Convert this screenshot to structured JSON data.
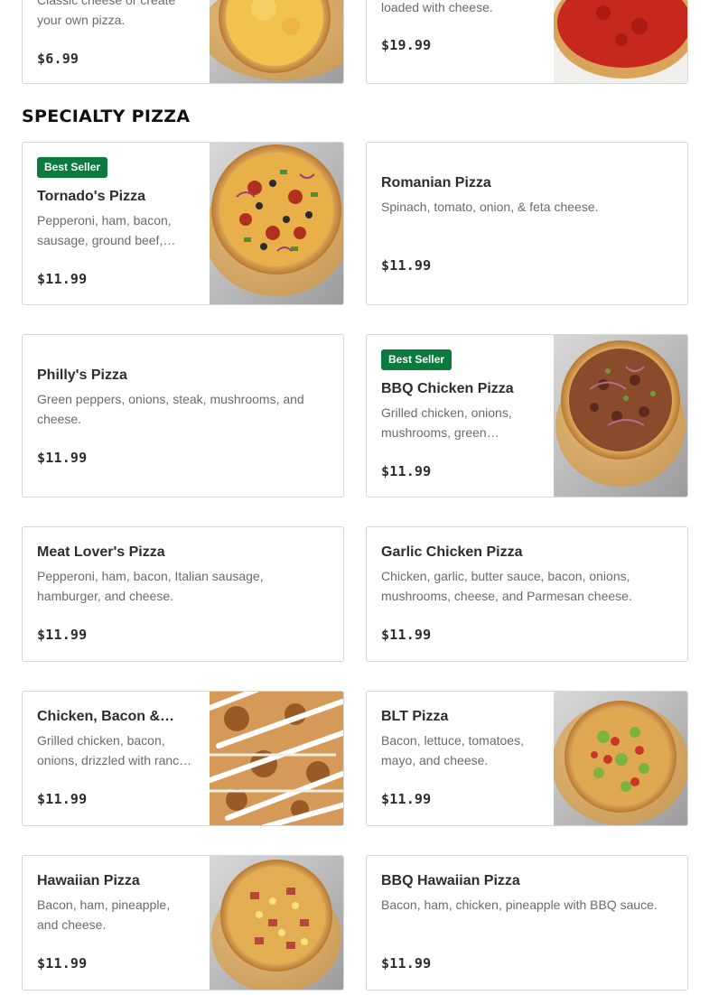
{
  "top_items": [
    {
      "desc": "Classic cheese or create your own pizza.",
      "price": "$6.99"
    },
    {
      "desc": "loaded with cheese.",
      "price": "$19.99"
    }
  ],
  "section": {
    "title": "SPECIALTY PIZZA"
  },
  "badge_label": "Best Seller",
  "items": [
    {
      "name": "Tornado's Pizza",
      "desc": "Pepperoni, ham, bacon, sausage, ground beef,…",
      "price": "$11.99"
    },
    {
      "name": "Romanian Pizza",
      "desc": "Spinach, tomato, onion, & feta cheese.",
      "price": "$11.99"
    },
    {
      "name": "Philly's Pizza",
      "desc": "Green peppers, onions, steak, mushrooms, and cheese.",
      "price": "$11.99"
    },
    {
      "name": "BBQ Chicken Pizza",
      "desc": "Grilled chicken, onions, mushrooms, green…",
      "price": "$11.99"
    },
    {
      "name": "Meat Lover's Pizza",
      "desc": "Pepperoni, ham, bacon, Italian sausage, hamburger, and cheese.",
      "price": "$11.99"
    },
    {
      "name": "Garlic Chicken Pizza",
      "desc": "Chicken, garlic, butter sauce, bacon, onions, mushrooms, cheese, and Parmesan cheese.",
      "price": "$11.99"
    },
    {
      "name": "Chicken, Bacon &…",
      "desc": "Grilled chicken, bacon, onions, drizzled with ranc…",
      "price": "$11.99"
    },
    {
      "name": "BLT Pizza",
      "desc": "Bacon, lettuce, tomatoes, mayo, and cheese.",
      "price": "$11.99"
    },
    {
      "name": "Hawaiian Pizza",
      "desc": "Bacon, ham, pineapple, and cheese.",
      "price": "$11.99"
    },
    {
      "name": "BBQ Hawaiian Pizza",
      "desc": "Bacon, ham, chicken, pineapple with BBQ sauce.",
      "price": "$11.99"
    }
  ]
}
